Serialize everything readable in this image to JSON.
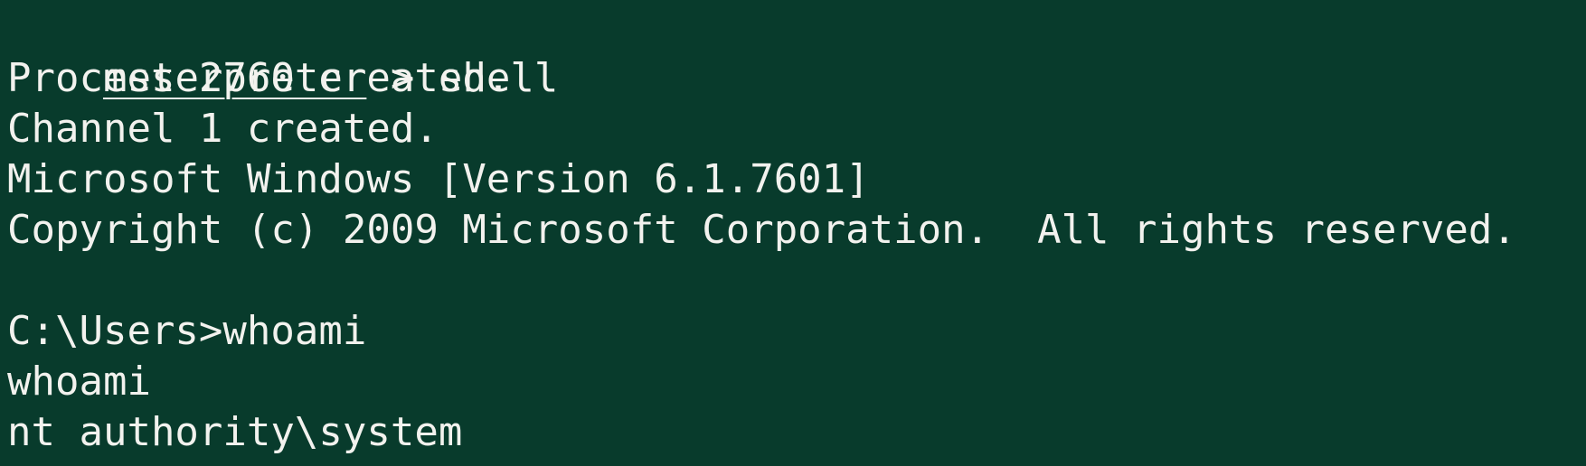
{
  "theme": {
    "background": "#083b2c",
    "foreground": "#f2f2ee"
  },
  "terminal": {
    "meterpreter_prompt": "meterpreter",
    "command_sep": " > ",
    "command": "shell",
    "lines": [
      "Process 2760 created.",
      "Channel 1 created.",
      "Microsoft Windows [Version 6.1.7601]",
      "Copyright (c) 2009 Microsoft Corporation.  All rights reserved.",
      "",
      "C:\\Users>whoami",
      "whoami",
      "nt authority\\system"
    ]
  }
}
